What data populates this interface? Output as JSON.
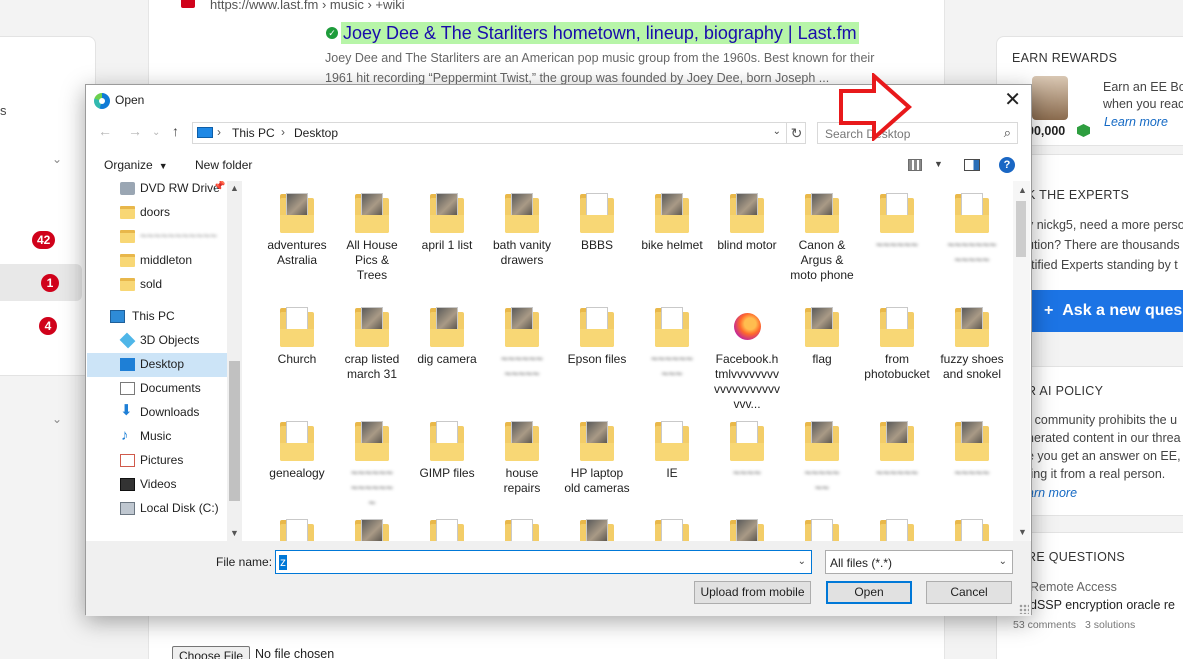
{
  "background": {
    "left": {
      "badges": [
        "42",
        "1",
        "4"
      ],
      "partial_text": "s"
    },
    "center": {
      "breadcrumb_url": "https://www.last.fm › music › +wiki",
      "result_title": "Joey Dee & The Starliters hometown, lineup, biography | Last.fm",
      "snippet": "Joey Dee and The Starliters are an American pop music group from the 1960s. Best known for their 1961 hit recording “Peppermint Twist,” the group was founded by Joey Dee, born Joseph ...",
      "choose_file_label": "Choose File",
      "no_file_text": "No file chosen"
    },
    "right": {
      "earn_rewards": {
        "heading": "EARN REWARDS",
        "text_line1": "Earn an EE Bo",
        "text_line2": "when you reac",
        "link": "Learn more",
        "points": "00,000"
      },
      "ask_experts": {
        "heading": "K THE EXPERTS",
        "line1": "y nickg5, need a more perso",
        "line2": "ution? There are thousands",
        "line3": "rtified Experts standing by t",
        "button": "Ask a new ques"
      },
      "ai_policy": {
        "heading": "R AI POLICY",
        "line1": "r community prohibits the u",
        "line2": "nerated content in our threa",
        "line3": "e you get an answer on EE,",
        "line4": "ting it from a real person.",
        "link": "arn more"
      },
      "more_questions": {
        "heading": "RE QUESTIONS",
        "item1": "Remote Access",
        "item2": "dSSP encryption oracle re",
        "meta_comments": "53 comments",
        "meta_solutions": "3 solutions"
      }
    }
  },
  "dialog": {
    "title": "Open",
    "address": {
      "crumbs": [
        "This PC",
        "Desktop"
      ]
    },
    "search_placeholder": "Search Desktop",
    "commands": {
      "organize": "Organize",
      "new_folder": "New folder"
    },
    "tree": [
      {
        "label": "DVD RW Drive",
        "icon": "dvd-drive-icon",
        "pinned": true
      },
      {
        "label": "doors",
        "icon": "folder-icon"
      },
      {
        "label": "",
        "icon": "folder-icon",
        "blurred": true
      },
      {
        "label": "middleton",
        "icon": "folder-icon"
      },
      {
        "label": "sold",
        "icon": "folder-icon"
      },
      {
        "label": "This PC",
        "icon": "this-pc-icon"
      },
      {
        "label": "3D Objects",
        "icon": "3d-objects-icon"
      },
      {
        "label": "Desktop",
        "icon": "desktop-icon",
        "selected": true
      },
      {
        "label": "Documents",
        "icon": "documents-icon"
      },
      {
        "label": "Downloads",
        "icon": "downloads-icon"
      },
      {
        "label": "Music",
        "icon": "music-icon"
      },
      {
        "label": "Pictures",
        "icon": "pictures-icon"
      },
      {
        "label": "Videos",
        "icon": "videos-icon"
      },
      {
        "label": "Local Disk (C:)",
        "icon": "local-disk-icon"
      }
    ],
    "files": [
      [
        "adventures Astralia",
        "All House Pics & Trees",
        "april 1 list",
        "bath vanity drawers",
        "BBBS",
        "bike helmet",
        "blind motor",
        "Canon & Argus & moto phone",
        "",
        ""
      ],
      [
        "Church",
        "crap listed march 31",
        "dig camera",
        "",
        "Epson files",
        "",
        "Facebook.htmlvvvvvvvvvvvvvvvvvvvvvv...",
        "flag",
        "from photobucket",
        "fuzzy shoes and snokel"
      ],
      [
        "genealogy",
        "",
        "GIMP files",
        "house repairs",
        "HP laptop old cameras",
        "IE",
        "",
        "",
        "",
        ""
      ]
    ],
    "file_name_label": "File name:",
    "file_name_value": "z",
    "file_type": "All files (*.*)",
    "buttons": {
      "upload": "Upload from mobile",
      "open": "Open",
      "cancel": "Cancel"
    }
  },
  "colors": {
    "accent": "#0078d7",
    "annotation_arrow": "#e8191b",
    "highlight": "#b7f5a8"
  }
}
